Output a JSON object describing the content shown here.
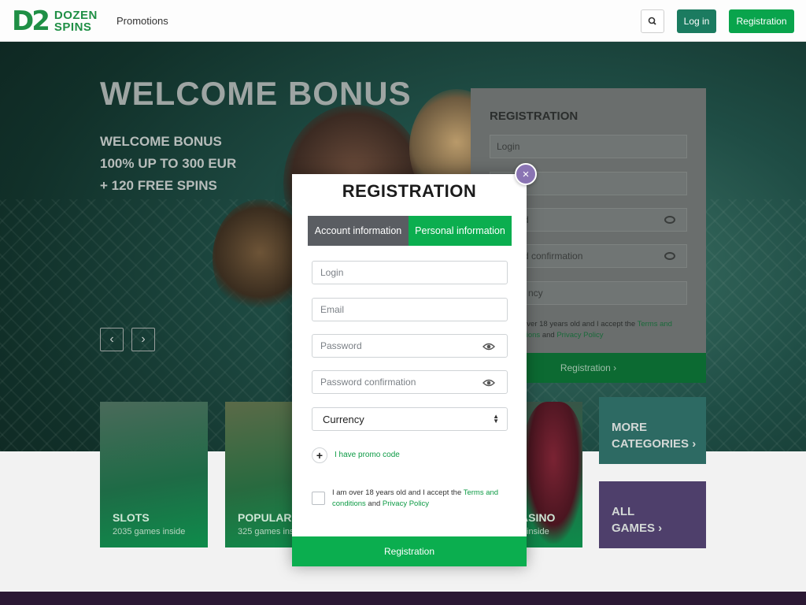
{
  "header": {
    "logo_mark": "D2",
    "logo_line1": "DOZEN",
    "logo_line2": "SPINS",
    "nav_promotions": "Promotions",
    "login_label": "Log in",
    "registration_label": "Registration"
  },
  "hero": {
    "title": "WELCOME BONUS",
    "sub_line1": "WELCOME BONUS",
    "sub_line2": "100% UP TO 300 EUR",
    "sub_line3": "+ 120 FREE SPINS",
    "prev": "‹",
    "next": "›"
  },
  "bg_form": {
    "title": "REGISTRATION",
    "login_placeholder": "Login",
    "password_partial": "rd",
    "confirm_partial": "rd confirmation",
    "currency_partial": "ncy",
    "agree_text_1": "over 18 years old and I accept the ",
    "terms_1": "Terms and",
    "terms_2": "itions",
    "and": " and ",
    "privacy": "Privacy Policy",
    "submit": "Registration ›"
  },
  "tiles": [
    {
      "title": "SLOTS",
      "count": "2035 games inside"
    },
    {
      "title": "POPULAR",
      "count": "325 games ins"
    },
    {
      "title": "ASINO",
      "count": "inside"
    }
  ],
  "side_tiles": {
    "more_1": "MORE",
    "more_2": "CATEGORIES ›",
    "all_1": "ALL",
    "all_2": "GAMES ›"
  },
  "modal": {
    "close": "×",
    "title": "REGISTRATION",
    "tab_account": "Account information",
    "tab_personal": "Personal information",
    "login_placeholder": "Login",
    "email_placeholder": "Email",
    "password_placeholder": "Password",
    "password_confirm_placeholder": "Password confirmation",
    "currency_value": "Currency",
    "promo_plus": "+",
    "promo_label": "I have promo code",
    "agree_prefix": "I am over 18 years old and I accept the ",
    "terms_link": "Terms and conditions",
    "and": " and ",
    "privacy_link": "Privacy Policy",
    "submit": "Registration"
  },
  "colors": {
    "brand_green": "#0bae4f",
    "dark_teal": "#1b7b60",
    "close_purple": "#8a74b3",
    "tab_gray": "#5a5d62"
  }
}
